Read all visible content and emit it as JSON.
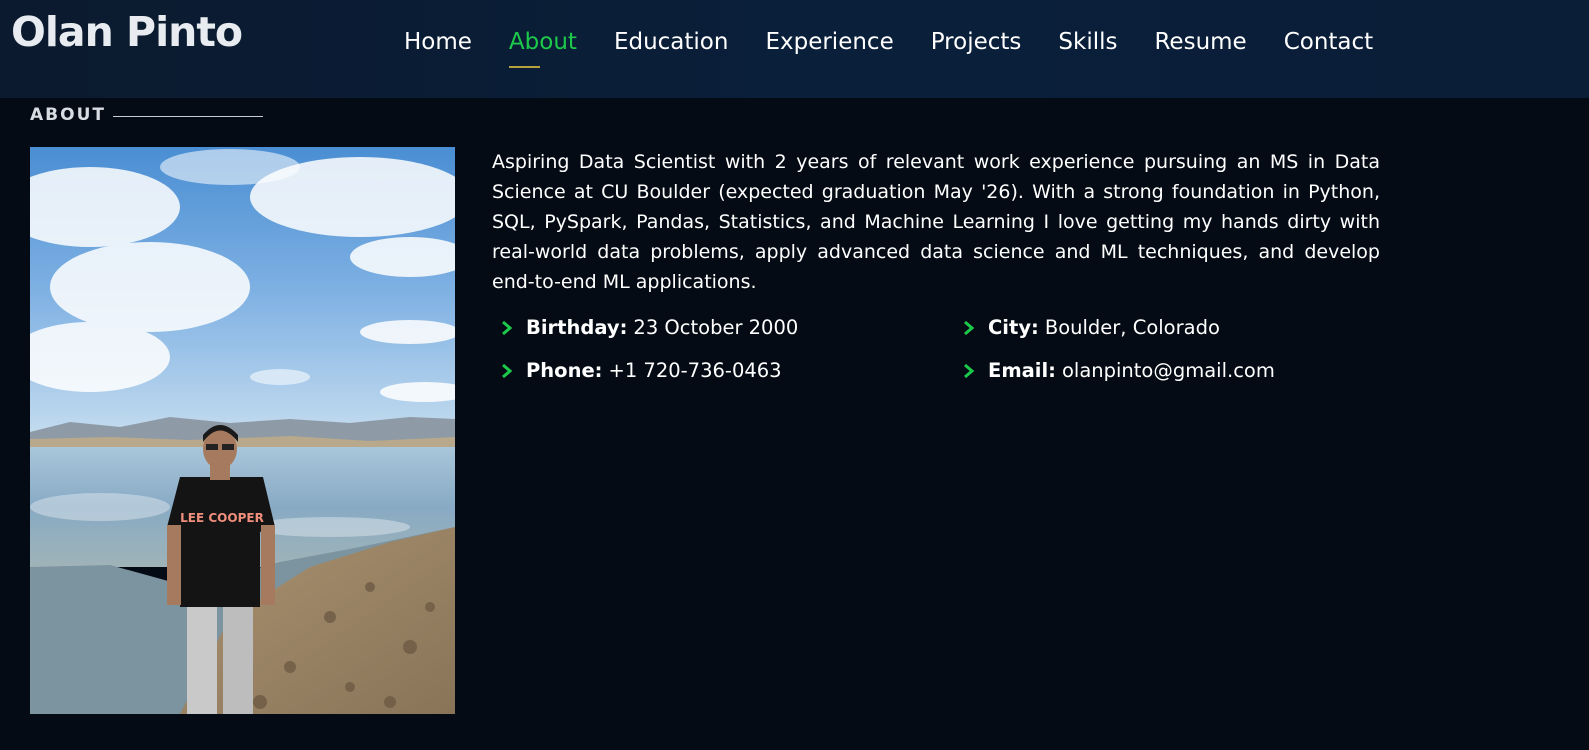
{
  "header": {
    "logo": "Olan Pinto",
    "nav": [
      {
        "label": "Home",
        "active": false
      },
      {
        "label": "About",
        "active": true
      },
      {
        "label": "Education",
        "active": false
      },
      {
        "label": "Experience",
        "active": false
      },
      {
        "label": "Projects",
        "active": false
      },
      {
        "label": "Skills",
        "active": false
      },
      {
        "label": "Resume",
        "active": false
      },
      {
        "label": "Contact",
        "active": false
      }
    ]
  },
  "about": {
    "section_title": "ABOUT",
    "bio": "Aspiring Data Scientist with 2 years of relevant work experience pursuing an MS in Data Science at CU Boulder (expected graduation May '26). With a strong foundation in Python, SQL, PySpark, Pandas, Statistics, and Machine Learning I love getting my hands dirty with real-world data problems, apply advanced data science and ML techniques, and develop end-to-end ML applications.",
    "details": {
      "birthday_label": "Birthday:",
      "birthday": "23 October 2000",
      "city_label": "City:",
      "city": "Boulder, Colorado",
      "phone_label": "Phone:",
      "phone": "+1 720-736-0463",
      "email_label": "Email:",
      "email": "olanpinto@gmail.com"
    },
    "shirt_text": "LEE COOPER"
  },
  "colors": {
    "accent": "#1dc94a",
    "background": "#040b14",
    "header": "#0a1f3a"
  }
}
